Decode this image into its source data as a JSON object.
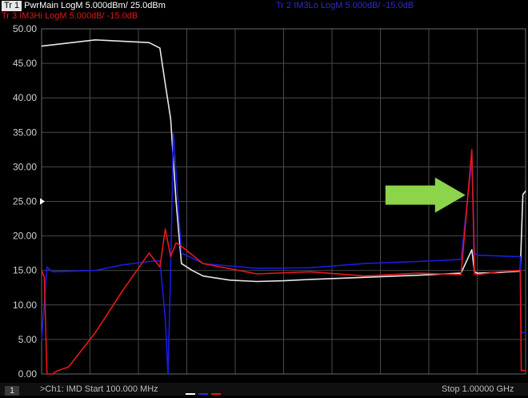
{
  "header": {
    "traces": [
      {
        "tr": "Tr 1",
        "label": "PwrMain LogM 5.000dBm/ 25.0dBm",
        "color": "#ffffff"
      },
      {
        "tr": "Tr 2",
        "label": "IM3Lo LogM 5.000dB/ -15.0dB",
        "color": "#2b2bd6"
      },
      {
        "tr": "Tr 3",
        "label": "IM3Hi LogM 5.000dB/ -15.0dB",
        "color": "#e01818"
      }
    ]
  },
  "status": {
    "channel_box": "1",
    "start": ">Ch1: IMD Start 100.000 MHz",
    "stop": "Stop 1.00000 GHz"
  },
  "chart_data": {
    "type": "line",
    "x_start": "100.000 MHz",
    "x_stop": "1.00000 GHz",
    "xlim": [
      0.1,
      1.0
    ],
    "ylim": [
      0,
      50
    ],
    "ytick_labels": [
      "50.00",
      "45.00",
      "40.00",
      "35.00",
      "30.00",
      "25.00",
      "20.00",
      "15.00",
      "10.00",
      "5.00",
      "0.00"
    ],
    "yticks": [
      50,
      45,
      40,
      35,
      30,
      25,
      20,
      15,
      10,
      5,
      0
    ],
    "x_divisions": 10,
    "grid": true,
    "reference_level": 25,
    "annotation": {
      "kind": "arrow",
      "color": "#8cd44a",
      "direction": "right",
      "target": [
        0.9,
        28
      ]
    },
    "series": [
      {
        "name": "PwrMain",
        "color": "#e8e8e8",
        "x": [
          0.1,
          0.2,
          0.3,
          0.32,
          0.33,
          0.34,
          0.35,
          0.36,
          0.38,
          0.4,
          0.45,
          0.5,
          0.55,
          0.6,
          0.7,
          0.8,
          0.88,
          0.9,
          0.905,
          0.91,
          0.95,
          0.99,
          0.995,
          1.0
        ],
        "y": [
          47.5,
          48.4,
          48.0,
          47.2,
          42.0,
          37.0,
          25.0,
          16.0,
          15.0,
          14.2,
          13.6,
          13.4,
          13.5,
          13.7,
          14.0,
          14.3,
          14.6,
          18.0,
          14.8,
          14.6,
          14.7,
          14.9,
          26.0,
          26.5
        ]
      },
      {
        "name": "IM3Lo",
        "color": "#1a1ae6",
        "x": [
          0.1,
          0.11,
          0.12,
          0.2,
          0.25,
          0.3,
          0.32,
          0.33,
          0.335,
          0.34,
          0.345,
          0.36,
          0.38,
          0.4,
          0.5,
          0.6,
          0.7,
          0.8,
          0.88,
          0.9,
          0.905,
          0.91,
          0.95,
          0.99,
          0.992,
          1.0
        ],
        "y": [
          5.0,
          15.5,
          14.8,
          15.0,
          15.8,
          16.3,
          16.4,
          8.0,
          0.0,
          15.0,
          35.0,
          17.5,
          16.8,
          16.0,
          15.3,
          15.4,
          16.0,
          16.3,
          16.6,
          31.0,
          17.5,
          17.2,
          17.1,
          17.0,
          6.0,
          6.0
        ]
      },
      {
        "name": "IM3Hi",
        "color": "#e81818",
        "x": [
          0.1,
          0.105,
          0.11,
          0.12,
          0.13,
          0.15,
          0.2,
          0.25,
          0.3,
          0.32,
          0.33,
          0.34,
          0.35,
          0.36,
          0.4,
          0.5,
          0.6,
          0.7,
          0.8,
          0.88,
          0.9,
          0.905,
          0.91,
          0.95,
          0.99,
          0.992,
          1.0
        ],
        "y": [
          15.0,
          14.0,
          0.0,
          0.0,
          0.5,
          1.0,
          6.0,
          12.0,
          17.5,
          15.5,
          21.0,
          17.0,
          19.0,
          18.5,
          16.0,
          14.5,
          14.8,
          14.2,
          14.6,
          14.4,
          32.5,
          14.5,
          14.4,
          14.8,
          15.0,
          0.5,
          0.5
        ]
      }
    ]
  }
}
